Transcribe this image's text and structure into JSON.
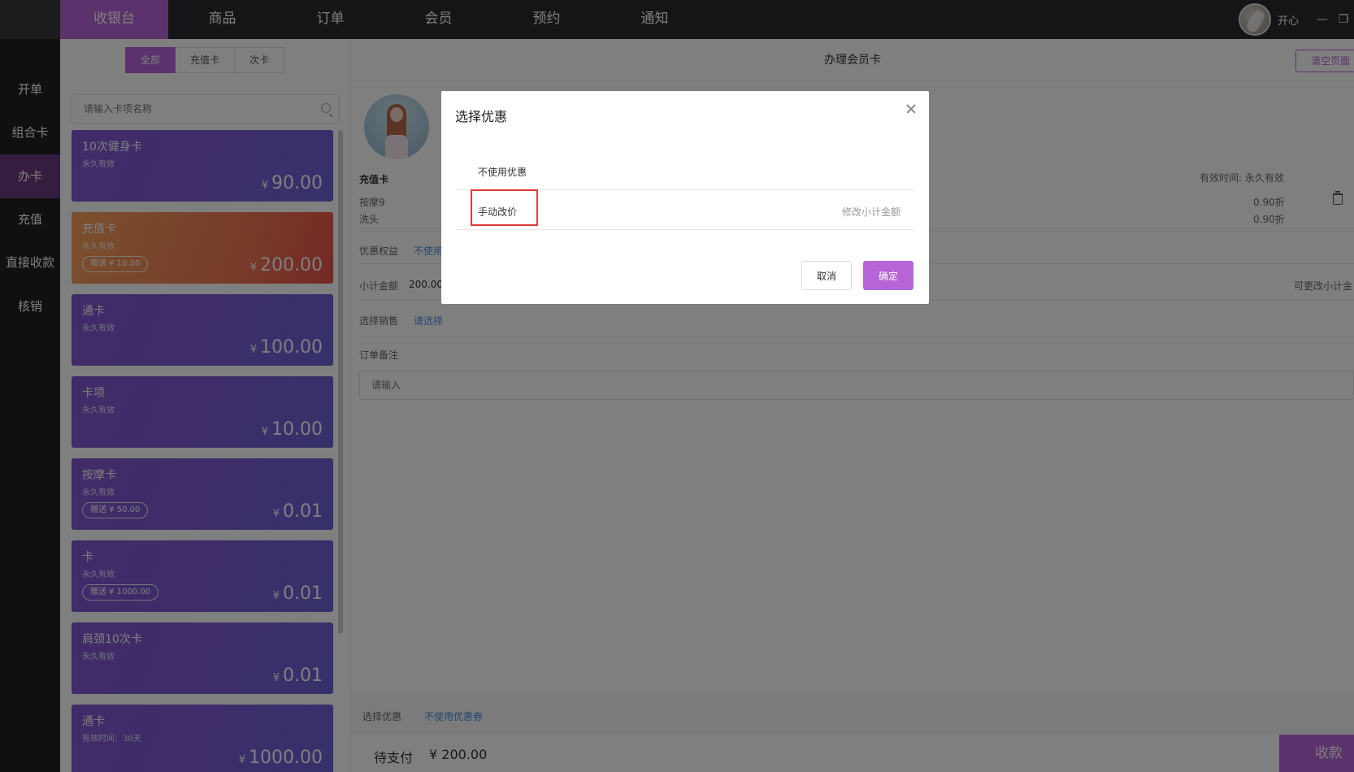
{
  "topnav": {
    "items": [
      {
        "label": "收银台",
        "active": true
      },
      {
        "label": "商品",
        "active": false
      },
      {
        "label": "订单",
        "active": false
      },
      {
        "label": "会员",
        "active": false
      },
      {
        "label": "预约",
        "active": false
      },
      {
        "label": "通知",
        "active": false
      }
    ],
    "user_name": "开心",
    "minimize_glyph": "—",
    "restore_glyph": "❐"
  },
  "sidebar": {
    "items": [
      {
        "label": "开单",
        "active": false
      },
      {
        "label": "组合卡",
        "active": false
      },
      {
        "label": "办卡",
        "active": true
      },
      {
        "label": "充值",
        "active": false
      },
      {
        "label": "直接收款",
        "active": false
      },
      {
        "label": "核销",
        "active": false
      }
    ]
  },
  "cardlist": {
    "filters": [
      {
        "label": "全部",
        "active": true
      },
      {
        "label": "充值卡",
        "active": false
      },
      {
        "label": "次卡",
        "active": false
      }
    ],
    "search_placeholder": "请输入卡项名称",
    "currency": "¥",
    "cards": [
      {
        "name": "10次健身卡",
        "validity": "永久有效",
        "gift": "",
        "price": "90.00",
        "style": "purple"
      },
      {
        "name": "充值卡",
        "validity": "永久有效",
        "gift": "赠送 ¥ 10.00",
        "price": "200.00",
        "style": "orange"
      },
      {
        "name": "通卡",
        "validity": "永久有效",
        "gift": "",
        "price": "100.00",
        "style": "purple"
      },
      {
        "name": "卡项",
        "validity": "永久有效",
        "gift": "",
        "price": "10.00",
        "style": "purple"
      },
      {
        "name": "按摩卡",
        "validity": "永久有效",
        "gift": "赠送 ¥ 50.00",
        "price": "0.01",
        "style": "purple"
      },
      {
        "name": "卡",
        "validity": "永久有效",
        "gift": "赠送 ¥ 1000.00",
        "price": "0.01",
        "style": "purple"
      },
      {
        "name": "肩颈10次卡",
        "validity": "永久有效",
        "gift": "",
        "price": "0.01",
        "style": "purple"
      },
      {
        "name": "通卡",
        "validity": "有效时间：30天",
        "gift": "",
        "price": "1000.00",
        "style": "purple"
      }
    ]
  },
  "main": {
    "title": "办理会员卡",
    "clear_button": "清空页面",
    "card_type_label": "充值卡",
    "validity_text": "有效时间: 永久有效",
    "services": [
      {
        "name": "按摩9",
        "discount": "0.90折"
      },
      {
        "name": "洗头",
        "discount": "0.90折"
      }
    ],
    "benefit_label": "优惠权益",
    "benefit_value": "不使用",
    "subtotal_label": "小计金额",
    "subtotal_value": "200.00",
    "subtotal_hint": "可更改小计金",
    "sales_label": "选择销售",
    "sales_value": "请选择",
    "remark_label": "订单备注",
    "remark_placeholder": "请输入",
    "coupon_label": "选择优惠",
    "coupon_value": "不使用优惠券",
    "pay_label": "待支付",
    "pay_amount": "¥ 200.00",
    "pay_button": "收款"
  },
  "modal": {
    "title": "选择优惠",
    "options": [
      {
        "label": "不使用优惠",
        "hint": ""
      },
      {
        "label": "手动改价",
        "hint": "修改小计金额"
      }
    ],
    "cancel_label": "取消",
    "confirm_label": "确定"
  },
  "colors": {
    "accent": "#b665d6",
    "topbar": "#2b2a2e",
    "sidebar": "#201f24",
    "highlight": "#e03a3a"
  }
}
